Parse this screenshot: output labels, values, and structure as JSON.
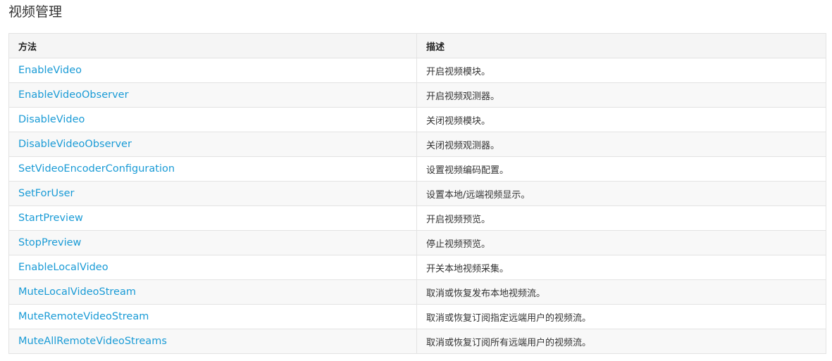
{
  "page": {
    "title": "视频管理"
  },
  "table": {
    "headers": {
      "method": "方法",
      "description": "描述"
    },
    "rows": [
      {
        "method": "EnableVideo",
        "description": "开启视频模块。"
      },
      {
        "method": "EnableVideoObserver",
        "description": "开启视频观测器。"
      },
      {
        "method": "DisableVideo",
        "description": "关闭视频模块。"
      },
      {
        "method": "DisableVideoObserver",
        "description": "关闭视频观测器。"
      },
      {
        "method": "SetVideoEncoderConfiguration",
        "description": "设置视频编码配置。"
      },
      {
        "method": "SetForUser",
        "description": "设置本地/远端视频显示。"
      },
      {
        "method": "StartPreview",
        "description": "开启视频预览。"
      },
      {
        "method": "StopPreview",
        "description": "停止视频预览。"
      },
      {
        "method": "EnableLocalVideo",
        "description": "开关本地视频采集。"
      },
      {
        "method": "MuteLocalVideoStream",
        "description": "取消或恢复发布本地视频流。"
      },
      {
        "method": "MuteRemoteVideoStream",
        "description": "取消或恢复订阅指定远端用户的视频流。"
      },
      {
        "method": "MuteAllRemoteVideoStreams",
        "description": "取消或恢复订阅所有远端用户的视频流。"
      }
    ]
  },
  "colors": {
    "link": "#1a9bd6",
    "header_bg": "#f5f5f5",
    "stripe_bg": "#f8f8f8",
    "border": "#e3e3e3"
  }
}
